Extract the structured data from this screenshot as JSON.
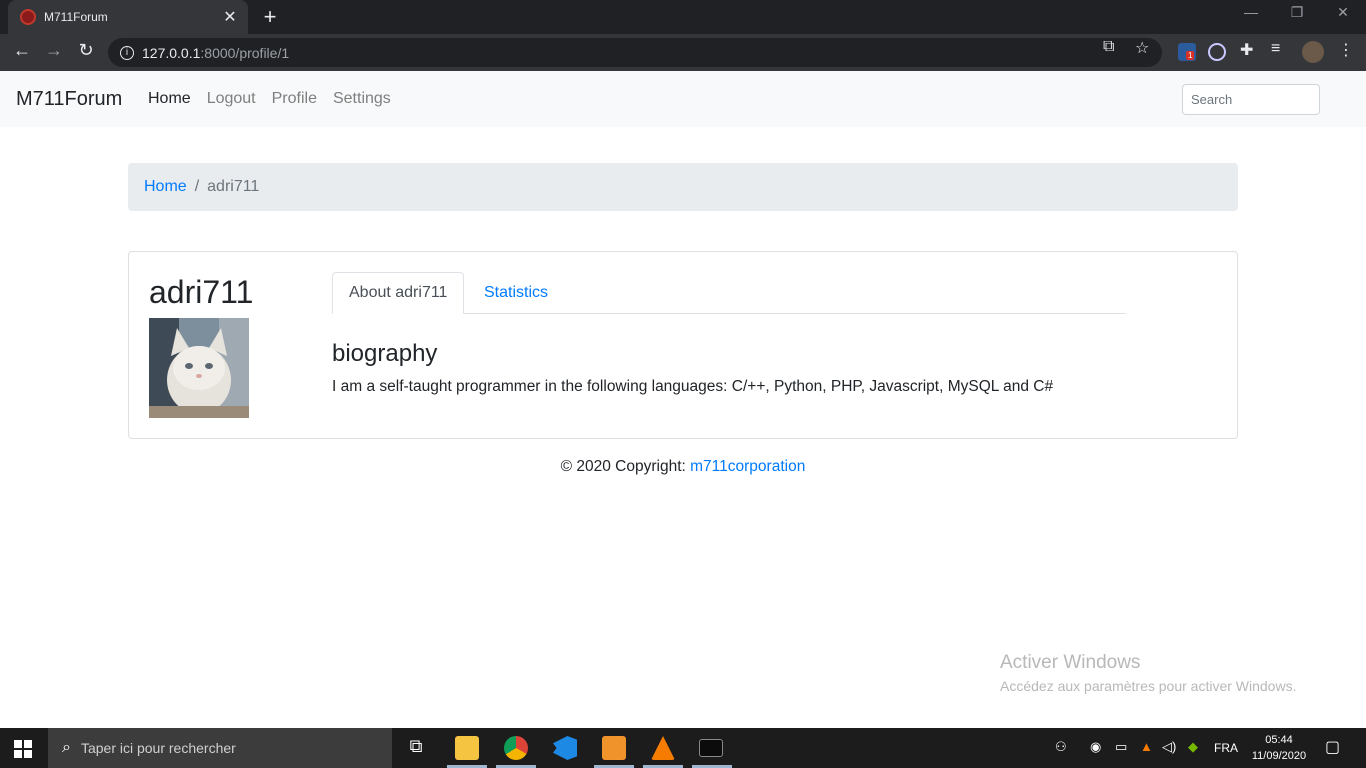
{
  "browser": {
    "tab_title": "M711Forum",
    "url_host": "127.0.0.1",
    "url_path": ":8000/profile/1",
    "extension_badge": "1"
  },
  "navbar": {
    "brand": "M711Forum",
    "links": [
      "Home",
      "Logout",
      "Profile",
      "Settings"
    ],
    "search_placeholder": "Search"
  },
  "breadcrumb": {
    "home": "Home",
    "separator": "/",
    "current": "adri711"
  },
  "profile": {
    "username": "adri711",
    "tabs": [
      "About adri711",
      "Statistics"
    ],
    "bio_heading": "biography",
    "bio_text": "I am a self-taught programmer in the following languages: C/++, Python, PHP, Javascript, MySQL and C#"
  },
  "footer": {
    "prefix": "© 2020 Copyright: ",
    "link": "m711corporation"
  },
  "watermark": {
    "title": "Activer Windows",
    "subtitle": "Accédez aux paramètres pour activer Windows."
  },
  "taskbar": {
    "search_placeholder": "Taper ici pour rechercher",
    "language": "FRA",
    "time": "05:44",
    "date": "11/09/2020"
  },
  "colors": {
    "link": "#007bff",
    "navbar_bg": "#f8f9fa",
    "breadcrumb_bg": "#e9ecef"
  }
}
